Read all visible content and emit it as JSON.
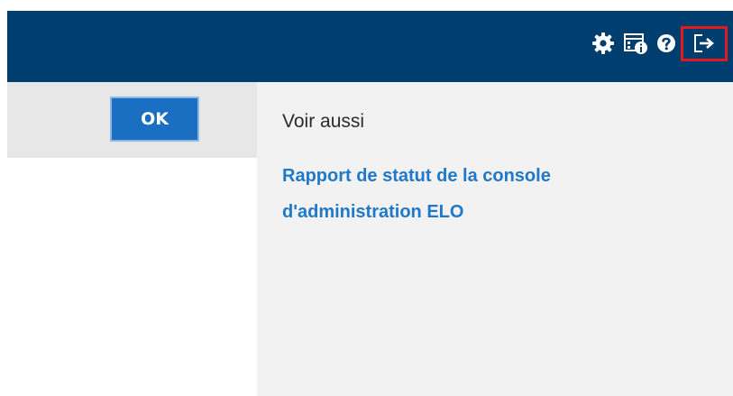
{
  "header": {
    "bg_color": "#003e6f",
    "toolbar": [
      {
        "icon": "gear-icon",
        "name": "settings"
      },
      {
        "icon": "info-panel-icon",
        "name": "information"
      },
      {
        "icon": "help-icon",
        "name": "help"
      },
      {
        "icon": "logout-icon",
        "name": "logout",
        "highlighted": true
      }
    ],
    "highlight_color": "#e11b1b"
  },
  "left_panel": {
    "ok_label": "OK",
    "ok_color": "#1b6fc2"
  },
  "see_also": {
    "title": "Voir aussi",
    "link_text": "Rapport de statut de la console d'administration ELO",
    "link_color": "#1f79c8"
  }
}
